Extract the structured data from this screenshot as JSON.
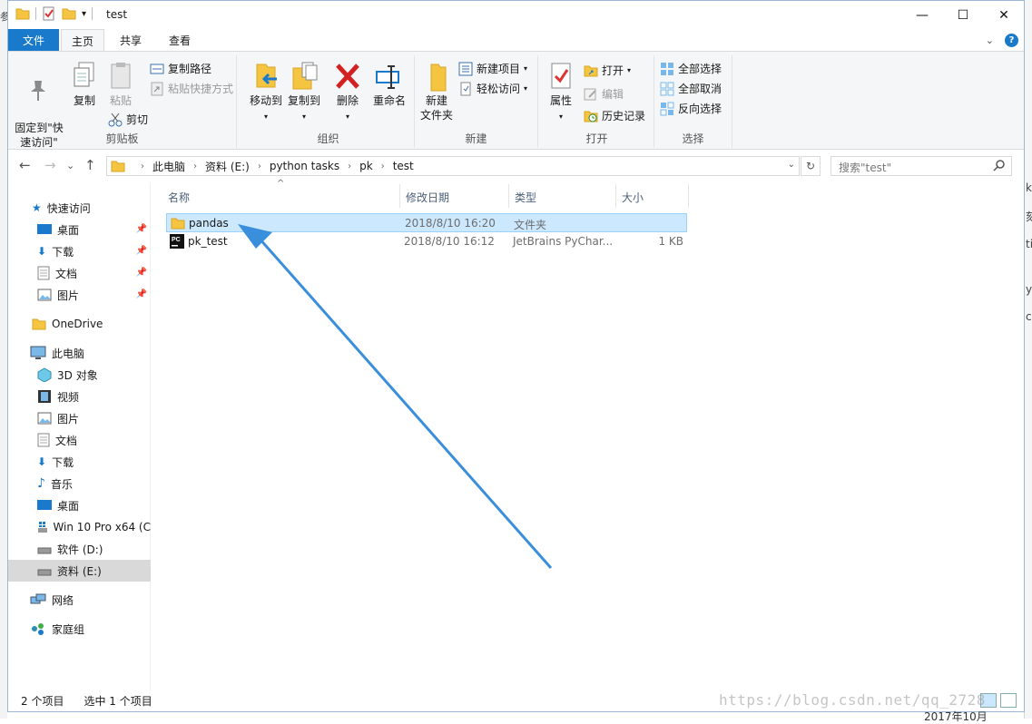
{
  "window": {
    "title": "test",
    "controls": {
      "minimize": "—",
      "maximize": "☐",
      "close": "✕"
    }
  },
  "ribbon": {
    "tabs": {
      "file": "文件",
      "home": "主页",
      "share": "共享",
      "view": "查看"
    },
    "clipboard": {
      "label": "剪贴板",
      "pin_quick_access": "固定到\"快\n速访问\"",
      "copy": "复制",
      "paste": "粘贴",
      "copy_path": "复制路径",
      "paste_shortcut": "粘贴快捷方式",
      "cut": "剪切"
    },
    "organize": {
      "label": "组织",
      "move_to": "移动到",
      "copy_to": "复制到",
      "delete": "删除",
      "rename": "重命名"
    },
    "new": {
      "label": "新建",
      "new_folder_1": "新建",
      "new_folder_2": "文件夹",
      "new_item": "新建项目",
      "easy_access": "轻松访问"
    },
    "open": {
      "label": "打开",
      "properties": "属性",
      "open": "打开",
      "edit": "编辑",
      "history": "历史记录"
    },
    "select": {
      "label": "选择",
      "select_all": "全部选择",
      "select_none": "全部取消",
      "invert": "反向选择"
    }
  },
  "address": {
    "crumbs": [
      "此电脑",
      "资料 (E:)",
      "python tasks",
      "pk",
      "test"
    ],
    "search_placeholder": "搜索\"test\""
  },
  "nav": {
    "quick_access": "快速访问",
    "desktop": "桌面",
    "downloads": "下载",
    "documents": "文档",
    "pictures": "图片",
    "onedrive": "OneDrive",
    "this_pc": "此电脑",
    "objects3d": "3D 对象",
    "videos": "视频",
    "pictures2": "图片",
    "documents2": "文档",
    "downloads2": "下载",
    "music": "音乐",
    "desktop2": "桌面",
    "drive_c": "Win 10 Pro x64 (C",
    "drive_d": "软件 (D:)",
    "drive_e": "资料 (E:)",
    "network": "网络",
    "homegroup": "家庭组"
  },
  "columns": {
    "name": "名称",
    "modified": "修改日期",
    "type": "类型",
    "size": "大小"
  },
  "files": [
    {
      "name": "pandas",
      "modified": "2018/8/10 16:20",
      "type": "文件夹",
      "size": ""
    },
    {
      "name": "pk_test",
      "modified": "2018/8/10 16:12",
      "type": "JetBrains PyChar...",
      "size": "1 KB"
    }
  ],
  "status": {
    "count": "2 个项目",
    "selected": "选中 1 个项目"
  },
  "watermark": "https://blog.csdn.net/qq_2728",
  "background_fragments": {
    "bottom": "2017年10月",
    "right": [
      "k",
      "刻",
      "ti",
      "y",
      "ca"
    ],
    "left": "参"
  },
  "colors": {
    "accent": "#1979ca",
    "selection": "#cce8ff",
    "arrow": "#3a8fdc",
    "folder": "#f5c542"
  }
}
